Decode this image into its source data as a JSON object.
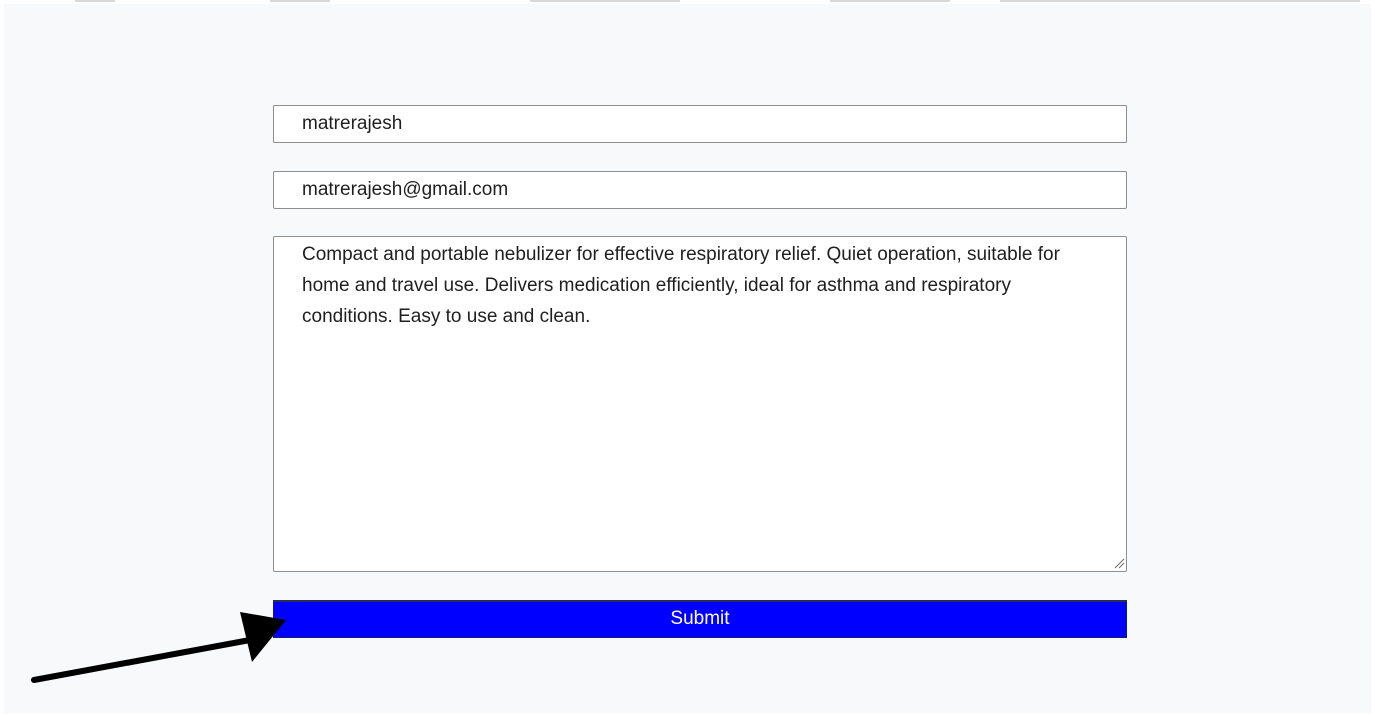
{
  "form": {
    "username_value": "matrerajesh",
    "email_value": "matrerajesh@gmail.com",
    "description_value": "Compact and portable nebulizer for effective respiratory relief. Quiet operation, suitable for home and travel use. Delivers medication efficiently, ideal for asthma and respiratory conditions. Easy to use and clean.",
    "submit_label": "Submit"
  },
  "colors": {
    "submit_background": "#0000ff",
    "submit_text": "#ffffff",
    "page_background": "#f7f9fa",
    "arrow": "#000000"
  },
  "icons": {
    "resize_grip": "resize-grip-icon",
    "annotation_arrow": "arrow-icon"
  }
}
